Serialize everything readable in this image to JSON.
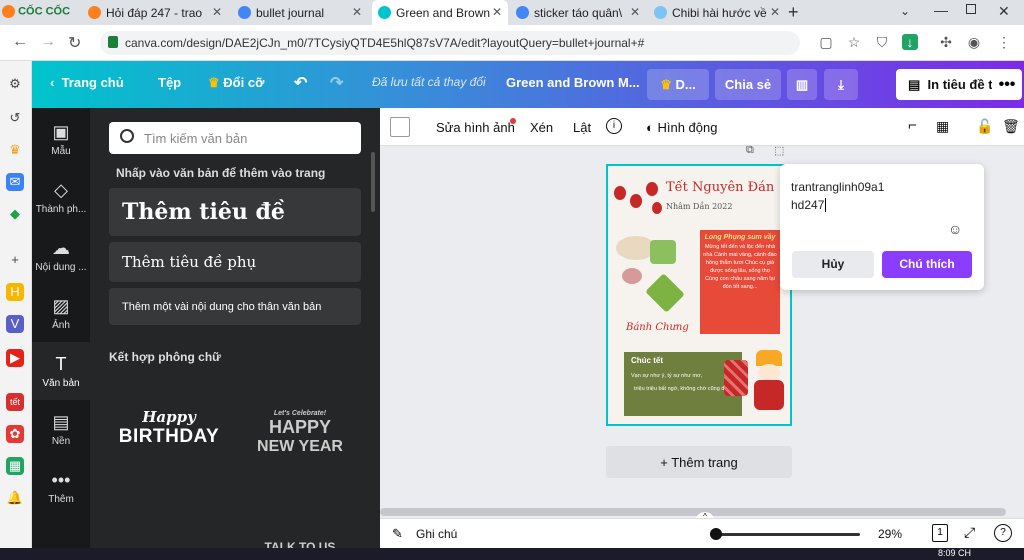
{
  "browser": {
    "tabs": [
      {
        "label": "Hỏi đáp 247 - trao",
        "favicon_color": "#ff7f1f"
      },
      {
        "label": "bullet journal",
        "favicon_color": "#4285f4"
      },
      {
        "label": "Green and Brown",
        "favicon_color": "#00c4cc",
        "active": true
      },
      {
        "label": "sticker táo quân\\",
        "favicon_color": "#4285f4"
      },
      {
        "label": "Chibi hài hước về",
        "favicon_color": "#7cc4f4"
      }
    ],
    "url": "canva.com/design/DAE2jCJn_m0/7TCysiyQTD4E5hlQ87sV7A/edit?layoutQuery=bullet+journal+#"
  },
  "app_logo": "CỐC CỐC",
  "topbar": {
    "home": "Trang chủ",
    "file": "Tệp",
    "resize": "Đổi cỡ",
    "saved": "Đã lưu tất cả thay đổi",
    "design_name": "Green and Brown M...",
    "d_label": "D...",
    "share": "Chia sẻ",
    "print": "In tiêu đề thư"
  },
  "rail": [
    {
      "label": "Mẫu"
    },
    {
      "label": "Thành ph..."
    },
    {
      "label": "Nội dung ..."
    },
    {
      "label": "Ảnh"
    },
    {
      "label": "Văn bản",
      "active": true
    },
    {
      "label": "Nền"
    },
    {
      "label": "Thêm"
    }
  ],
  "panel": {
    "search_placeholder": "Tìm kiếm văn bản",
    "hint": "Nhấp vào văn bản để thêm vào trang",
    "heading": "Thêm tiêu đề",
    "subheading": "Thêm tiêu đề phụ",
    "body": "Thêm một vài nội dung cho thân văn bản",
    "combos_title": "Kết hợp phông chữ",
    "combo1_top": "Happy",
    "combo1_bottom": "BIRTHDAY",
    "combo2_top": "Let's Celebrate!",
    "combo2_main": "HAPPY",
    "combo2_bottom": "NEW YEAR",
    "combo3": "TALK TO US"
  },
  "canvas_toolbar": {
    "edit_image": "Sửa hình ảnh",
    "crop": "Xén",
    "flip": "Lật",
    "animate": "Hình động"
  },
  "design": {
    "title": "Tết Nguyên Đán",
    "subtitle": "Nhâm Dần 2022",
    "red_title": "Long Phụng sum vầy",
    "red_text": "Mừng tết đến và lộc đến nhà nhà Cành mai vàng, cành đào hồng thắm tươi Chúc cụ già được sống lâu, sống thọ Cùng con cháu sang năm lại đón tết sang...",
    "cake_label": "Bánh Chưng",
    "green_title": "Chúc tết",
    "green_line1": "Vạn sự như ý, tỷ sự như mơ,",
    "green_line2": "triệu triệu bất ngờ, không chờ cũng đến."
  },
  "add_page": "+ Thêm trang",
  "comment": {
    "text_line1": "trantranglinh09a1",
    "text_line2": "hd247",
    "cancel": "Hủy",
    "submit": "Chú thích"
  },
  "bottom": {
    "notes": "Ghi chú",
    "zoom": "29%",
    "page_num": "1"
  },
  "clock": "8:09 CH"
}
